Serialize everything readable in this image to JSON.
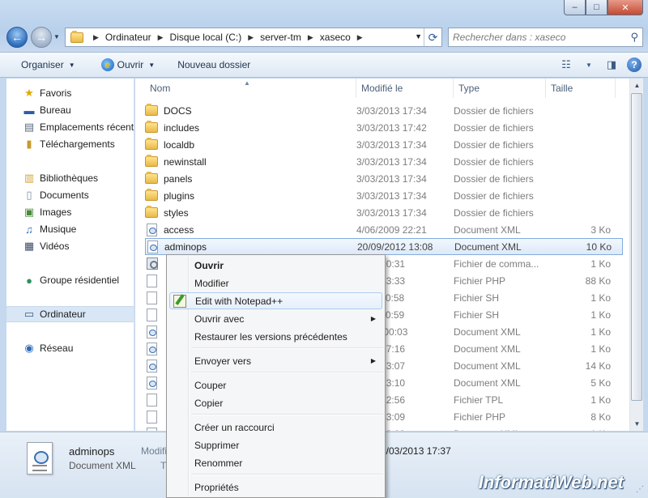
{
  "window": {
    "caption": {
      "minimize": "–",
      "maximize": "□",
      "close": "✕"
    }
  },
  "nav": {
    "back": "←",
    "forward": "→",
    "breadcrumb": [
      "Ordinateur",
      "Disque local (C:)",
      "server-tm",
      "xaseco"
    ],
    "search_placeholder": "Rechercher dans : xaseco"
  },
  "toolbar": {
    "organize": "Organiser",
    "open": "Ouvrir",
    "new_folder": "Nouveau dossier"
  },
  "sidebar": {
    "favorites": "Favoris",
    "bureau": "Bureau",
    "emplacements": "Emplacements récents",
    "telechargements": "Téléchargements",
    "bibliotheques": "Bibliothèques",
    "documents": "Documents",
    "images": "Images",
    "musique": "Musique",
    "videos": "Vidéos",
    "groupe": "Groupe résidentiel",
    "ordinateur": "Ordinateur",
    "reseau": "Réseau"
  },
  "list": {
    "columns": {
      "name": "Nom",
      "modified": "Modifié le",
      "type": "Type",
      "size": "Taille"
    },
    "rows": [
      {
        "name": "DOCS",
        "date": "3/03/2013 17:34",
        "type": "Dossier de fichiers",
        "size": "",
        "icon": "folder-icon"
      },
      {
        "name": "includes",
        "date": "3/03/2013 17:42",
        "type": "Dossier de fichiers",
        "size": "",
        "icon": "folder-icon"
      },
      {
        "name": "localdb",
        "date": "3/03/2013 17:34",
        "type": "Dossier de fichiers",
        "size": "",
        "icon": "folder-icon"
      },
      {
        "name": "newinstall",
        "date": "3/03/2013 17:34",
        "type": "Dossier de fichiers",
        "size": "",
        "icon": "folder-icon"
      },
      {
        "name": "panels",
        "date": "3/03/2013 17:34",
        "type": "Dossier de fichiers",
        "size": "",
        "icon": "folder-icon"
      },
      {
        "name": "plugins",
        "date": "3/03/2013 17:34",
        "type": "Dossier de fichiers",
        "size": "",
        "icon": "folder-icon"
      },
      {
        "name": "styles",
        "date": "3/03/2013 17:34",
        "type": "Dossier de fichiers",
        "size": "",
        "icon": "folder-icon"
      },
      {
        "name": "access",
        "date": "4/06/2009 22:21",
        "type": "Document XML",
        "size": "3 Ko",
        "icon": "xml-file-icon"
      },
      {
        "name": "adminops",
        "date": "20/09/2012 13:08",
        "type": "Document XML",
        "size": "10 Ko",
        "icon": "xml-file-icon"
      },
      {
        "name": "",
        "date": "2006 10:31",
        "type": "Fichier de comma...",
        "size": "1 Ko",
        "icon": "cmd-file-icon"
      },
      {
        "name": "",
        "date": "2012 13:33",
        "type": "Fichier PHP",
        "size": "88 Ko",
        "icon": "file-icon"
      },
      {
        "name": "",
        "date": "2011 10:58",
        "type": "Fichier SH",
        "size": "1 Ko",
        "icon": "file-icon"
      },
      {
        "name": "",
        "date": "2011 10:59",
        "type": "Fichier SH",
        "size": "1 Ko",
        "icon": "file-icon"
      },
      {
        "name": "",
        "date": "/2008 00:03",
        "type": "Document XML",
        "size": "1 Ko",
        "icon": "xml-file-icon"
      },
      {
        "name": "",
        "date": "2009 17:16",
        "type": "Document XML",
        "size": "1 Ko",
        "icon": "xml-file-icon"
      },
      {
        "name": "",
        "date": "2012 13:07",
        "type": "Document XML",
        "size": "14 Ko",
        "icon": "xml-file-icon"
      },
      {
        "name": "",
        "date": "2012 13:10",
        "type": "Document XML",
        "size": "5 Ko",
        "icon": "xml-file-icon"
      },
      {
        "name": "",
        "date": "2010 22:56",
        "type": "Fichier TPL",
        "size": "1 Ko",
        "icon": "file-icon"
      },
      {
        "name": "",
        "date": "2012 13:09",
        "type": "Fichier PHP",
        "size": "8 Ko",
        "icon": "file-icon"
      },
      {
        "name": "",
        "date": "2012 13:08",
        "type": "Document XML",
        "size": "1 Ko",
        "icon": "xml-file-icon"
      }
    ]
  },
  "details": {
    "name": "adminops",
    "type": "Document XML",
    "modified_label": "Modifi",
    "extra": "T",
    "date": "3/03/2013 17:37"
  },
  "context_menu": {
    "open": "Ouvrir",
    "edit": "Modifier",
    "notepad": "Edit with Notepad++",
    "open_with": "Ouvrir avec",
    "restore": "Restaurer les versions précédentes",
    "send_to": "Envoyer vers",
    "cut": "Couper",
    "copy": "Copier",
    "shortcut": "Créer un raccourci",
    "delete": "Supprimer",
    "rename": "Renommer",
    "properties": "Propriétés"
  },
  "watermark": "InformatiWeb.net",
  "colors": {
    "selection": "#dde9f8",
    "menu_highlight": "#e6effa",
    "accent": "#2d6cb9"
  }
}
